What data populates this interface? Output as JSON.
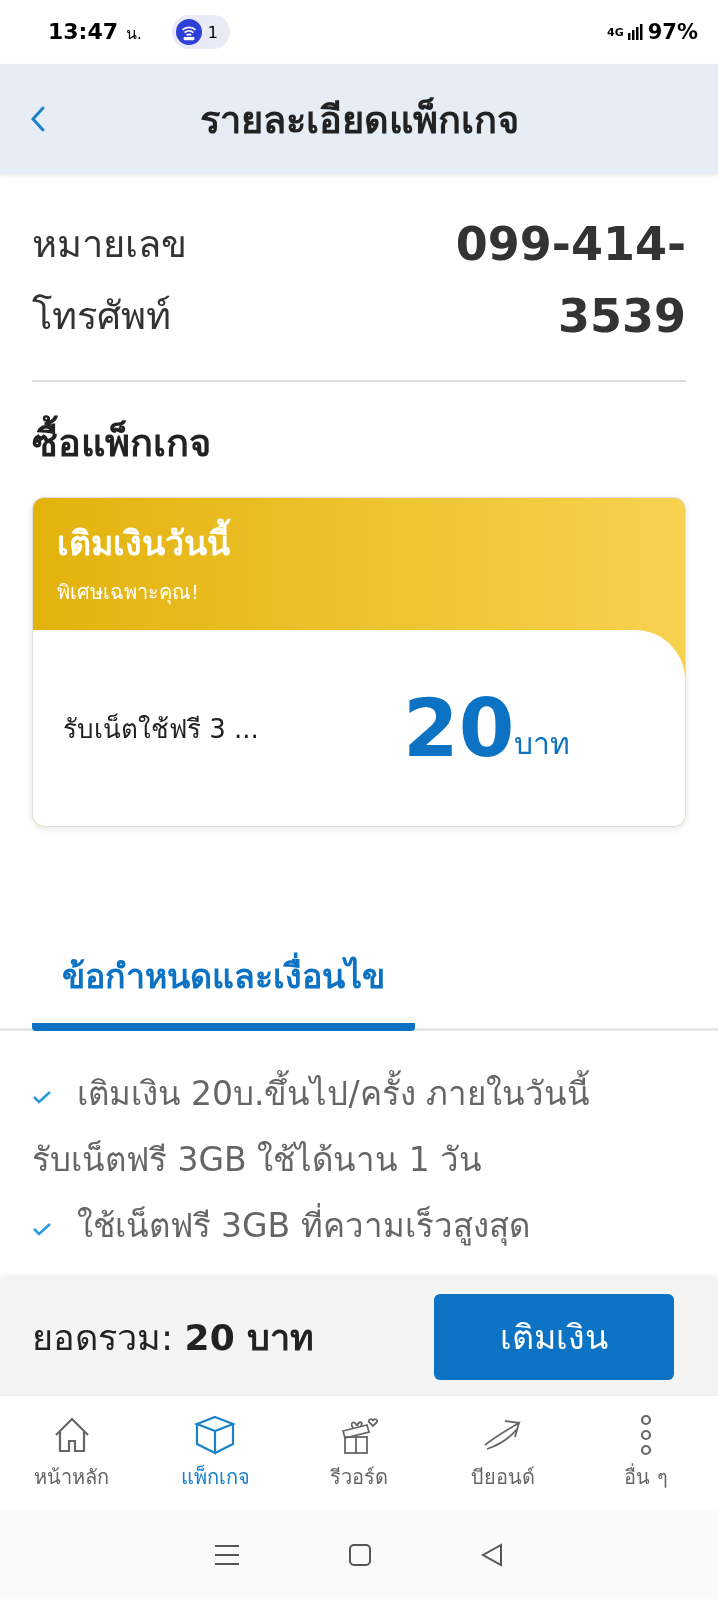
{
  "status_bar": {
    "time": "13:47",
    "time_suffix": "น.",
    "notification_count": "1",
    "network": "4G",
    "battery": "97%"
  },
  "header": {
    "title": "รายละเอียดแพ็กเกจ"
  },
  "phone": {
    "label": "หมายเลข โทรศัพท์",
    "number": "099-414-3539"
  },
  "section_title": "ซื้อแพ็กเกจ",
  "offer": {
    "title": "เติมเงินวันนี้",
    "subtitle": "พิเศษเฉพาะคุณ!",
    "description": "รับเน็ตใช้ฟรี 3 ...",
    "price": "20",
    "unit": "บาท"
  },
  "tabs": [
    {
      "label": "ข้อกำหนดและเงื่อนไข",
      "selected": true
    }
  ],
  "terms": [
    {
      "lines": [
        "เติมเงิน 20บ.ขึ้นไป/ครั้ง ภายในวันนี้",
        "รับเน็ตฟรี 3GB ใช้ได้นาน 1 วัน"
      ]
    },
    {
      "lines": [
        "ใช้เน็ตฟรี 3GB ที่ความเร็วสูงสุด"
      ]
    }
  ],
  "footer": {
    "total_label": "ยอดรวม:",
    "total": "20 บาท",
    "button": "เติมเงิน"
  },
  "nav": [
    {
      "kind": "home",
      "label": "หน้าหลัก",
      "selected": false
    },
    {
      "kind": "box",
      "label": "แพ็กเกจ",
      "selected": true
    },
    {
      "kind": "gift",
      "label": "รีวอร์ด",
      "selected": false
    },
    {
      "kind": "plane",
      "label": "บียอนด์",
      "selected": false
    },
    {
      "kind": "more",
      "label": "อื่น ๆ",
      "selected": false
    }
  ]
}
